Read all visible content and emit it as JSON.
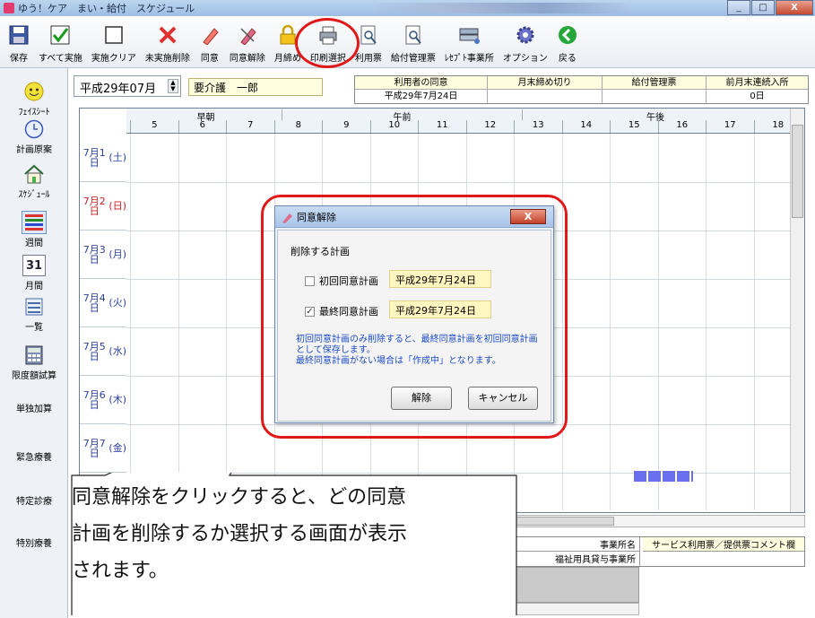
{
  "window": {
    "title": "ゆう！ケア　まい・給付　スケジュール",
    "close_label": "X",
    "minimize_label": "_",
    "maximize_label": "□"
  },
  "toolbar": [
    {
      "label": "保存",
      "icon": "save-icon"
    },
    {
      "label": "すべて実施",
      "icon": "check-icon"
    },
    {
      "label": "実施クリア",
      "icon": "square-icon"
    },
    {
      "label": "未実施削除",
      "icon": "x-icon"
    },
    {
      "label": "同意",
      "icon": "pencil-icon"
    },
    {
      "label": "同意解除",
      "icon": "eraser-pencil-icon"
    },
    {
      "label": "月締め",
      "icon": "lock-icon"
    },
    {
      "label": "印刷選択",
      "icon": "printer-icon"
    },
    {
      "label": "利用票",
      "icon": "preview-icon"
    },
    {
      "label": "給付管理票",
      "icon": "preview-icon"
    },
    {
      "label": "ﾚｾﾌﾟﾄ事業所",
      "icon": "server-icon"
    },
    {
      "label": "オプション",
      "icon": "gear-icon"
    },
    {
      "label": "戻る",
      "icon": "back-icon"
    }
  ],
  "sidebar": [
    {
      "label": "ﾌｪｲｽｼｰﾄ",
      "icon": "smiley-icon"
    },
    {
      "label": "計画原案",
      "icon": "clock-icon"
    },
    {
      "label": "ｽｹｼﾞｭｰﾙ",
      "icon": "house-icon"
    },
    {
      "label": "週間",
      "icon": "week-icon"
    },
    {
      "label": "月間",
      "icon": "calendar-icon",
      "day": "31"
    },
    {
      "label": "一覧",
      "icon": "list-icon"
    },
    {
      "label": "限度額試算",
      "icon": "calculator-icon"
    },
    {
      "label": "単独加算",
      "icon": ""
    },
    {
      "label": "緊急療養",
      "icon": ""
    },
    {
      "label": "特定診療",
      "icon": ""
    },
    {
      "label": "特別療養",
      "icon": ""
    }
  ],
  "header": {
    "period": "平成29年07月",
    "kaigo": "要介護　一郎",
    "columns": [
      "利用者の同意",
      "月末締め切り",
      "給付管理票",
      "前月末連続入所"
    ],
    "values": [
      "平成29年7月24日",
      "",
      "",
      "0日"
    ]
  },
  "grid": {
    "periods": [
      "早朝",
      "午前",
      "午後"
    ],
    "hours": [
      "5",
      "6",
      "7",
      "8",
      "9",
      "10",
      "11",
      "12",
      "13",
      "14",
      "15",
      "16",
      "17",
      "18"
    ],
    "days": [
      {
        "date": "7月1日",
        "dow": "(土)"
      },
      {
        "date": "7月2日",
        "dow": "(日)",
        "sunday": true
      },
      {
        "date": "7月3日",
        "dow": "(月)"
      },
      {
        "date": "7月4日",
        "dow": "(火)"
      },
      {
        "date": "7月5日",
        "dow": "(水)"
      },
      {
        "date": "7月6日",
        "dow": "(木)"
      },
      {
        "date": "7月7日",
        "dow": "(金)"
      }
    ],
    "schedule_color": "#6a6ff0"
  },
  "bottom": {
    "office_header": "事業所名",
    "office_value": "福祉用具貸与事業所",
    "comment_header": "サービス利用票／提供票コメント欄",
    "scroll_label": "III"
  },
  "dialog": {
    "title": "同意解除",
    "close_label": "X",
    "section_label": "削除する計画",
    "first_plan": {
      "label": "初回同意計画",
      "date": "平成29年7月24日",
      "checked": false
    },
    "final_plan": {
      "label": "最終同意計画",
      "date": "平成29年7月24日",
      "checked": true
    },
    "note_lines": [
      "初回同意計画のみ削除すると、最終同意計画を初回同意計画",
      "として保存します。",
      "最終同意計画がない場合は「作成中」となります。"
    ],
    "release_button": "解除",
    "cancel_button": "キャンセル"
  },
  "callout": {
    "lines": [
      "同意解除をクリックすると、どの同意",
      "計画を削除するか選択する画面が表示",
      "されます。"
    ]
  },
  "colors": {
    "annotation_red": "#e01818",
    "note_blue": "#1b4bc6"
  }
}
